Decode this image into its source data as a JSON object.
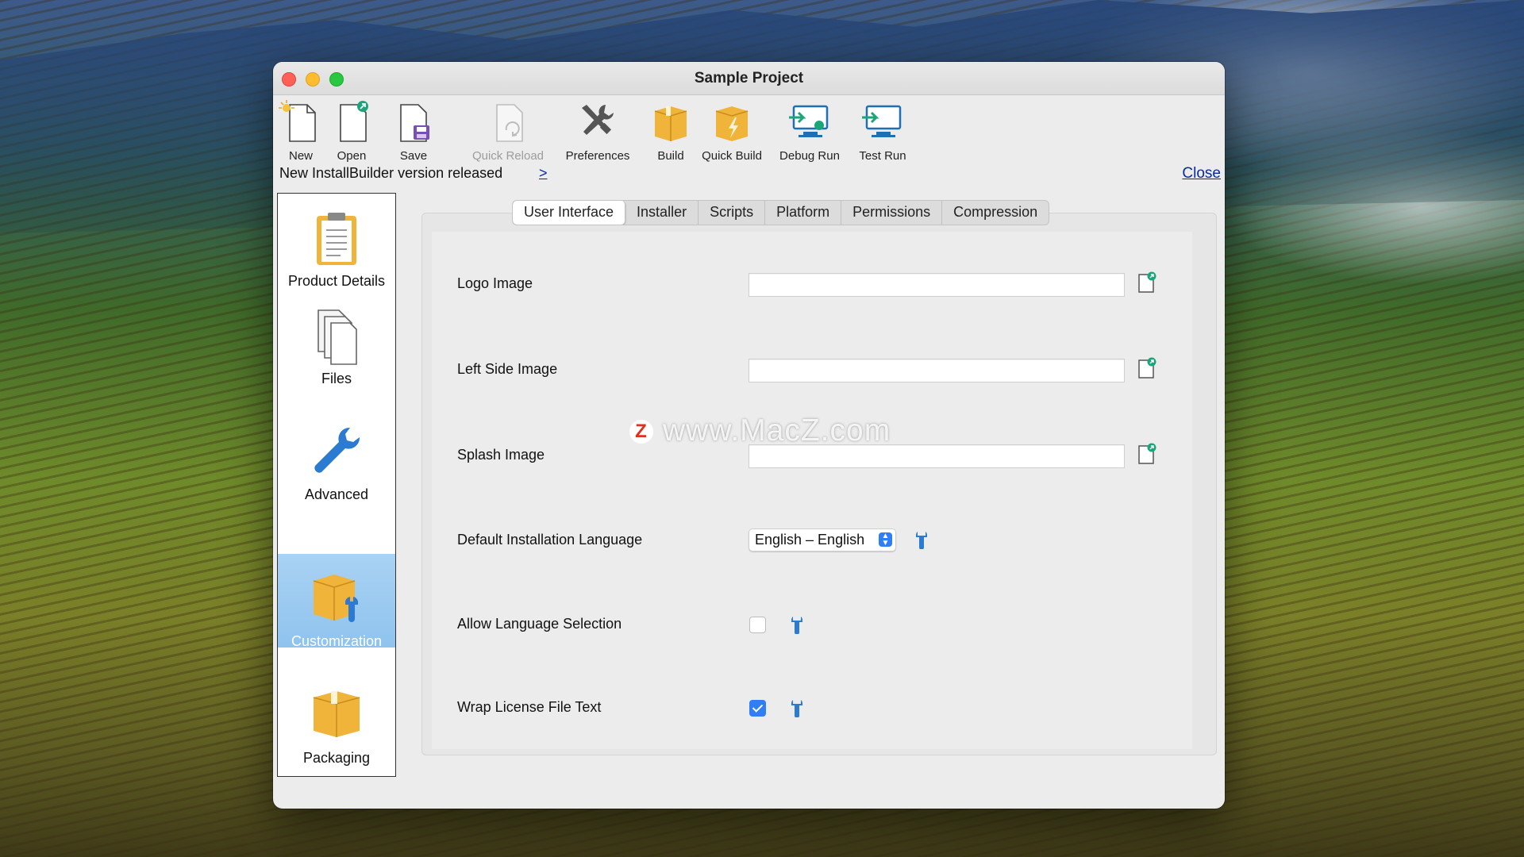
{
  "window": {
    "title": "Sample Project"
  },
  "toolbar": {
    "new": "New",
    "open": "Open",
    "save": "Save",
    "quick_reload": "Quick Reload",
    "preferences": "Preferences",
    "build": "Build",
    "quick_build": "Quick Build",
    "debug_run": "Debug Run",
    "test_run": "Test Run"
  },
  "notice": {
    "text": "New InstallBuilder version released",
    "link": ">",
    "close": "Close"
  },
  "sidebar": {
    "items": [
      {
        "label": "Product Details",
        "icon": "clipboard-icon"
      },
      {
        "label": "Files",
        "icon": "files-icon"
      },
      {
        "label": "Advanced",
        "icon": "wrench-icon"
      },
      {
        "label": "Customization",
        "icon": "box-wrench-icon"
      },
      {
        "label": "Packaging",
        "icon": "box-icon"
      }
    ],
    "active": "Customization"
  },
  "tabs": [
    "User Interface",
    "Installer",
    "Scripts",
    "Platform",
    "Permissions",
    "Compression"
  ],
  "active_tab": "User Interface",
  "form": {
    "logo_image": {
      "label": "Logo Image",
      "value": ""
    },
    "left_side_image": {
      "label": "Left Side Image",
      "value": ""
    },
    "splash_image": {
      "label": "Splash Image",
      "value": ""
    },
    "default_language": {
      "label": "Default Installation Language",
      "value": "English – English"
    },
    "allow_language_selection": {
      "label": "Allow Language Selection",
      "checked": false
    },
    "wrap_license": {
      "label": "Wrap License File Text",
      "checked": true
    }
  },
  "watermark": {
    "badge": "Z",
    "text": "www.MacZ.com"
  },
  "colors": {
    "accent": "#2f7ef6",
    "link": "#0b2a9e",
    "active_sidebar": "#9ccaf0"
  }
}
